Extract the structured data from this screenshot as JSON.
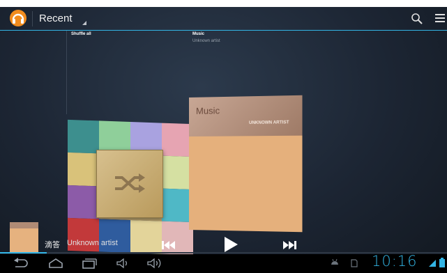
{
  "action_bar": {
    "title": "Recent",
    "app_icon": "headphones-icon",
    "search_icon": "search-icon",
    "menu_icon": "overflow-menu-icon"
  },
  "grid": {
    "left_label": "Shuffle all",
    "right_title": "Music",
    "right_subtitle": "Unknown artist"
  },
  "music_card": {
    "title": "Music",
    "artist": "UNKNOWN ARTIST"
  },
  "shuffle_icon": "shuffle-icon",
  "now_playing": {
    "song": "滴答",
    "artist": "Unknown artist",
    "progress": 0.105,
    "prev_icon": "skip-previous-icon",
    "play_icon": "play-icon",
    "next_icon": "skip-next-icon"
  },
  "system_bar": {
    "time": "10:16",
    "icons": [
      "back-icon",
      "home-icon",
      "recents-icon",
      "volume-down-icon",
      "volume-up-icon",
      "usb-debug-icon",
      "sd-card-icon",
      "wifi-icon",
      "battery-icon"
    ]
  },
  "colors": {
    "accent": "#33b5e5",
    "background": "#1c2533",
    "card": "#e5b07c"
  }
}
